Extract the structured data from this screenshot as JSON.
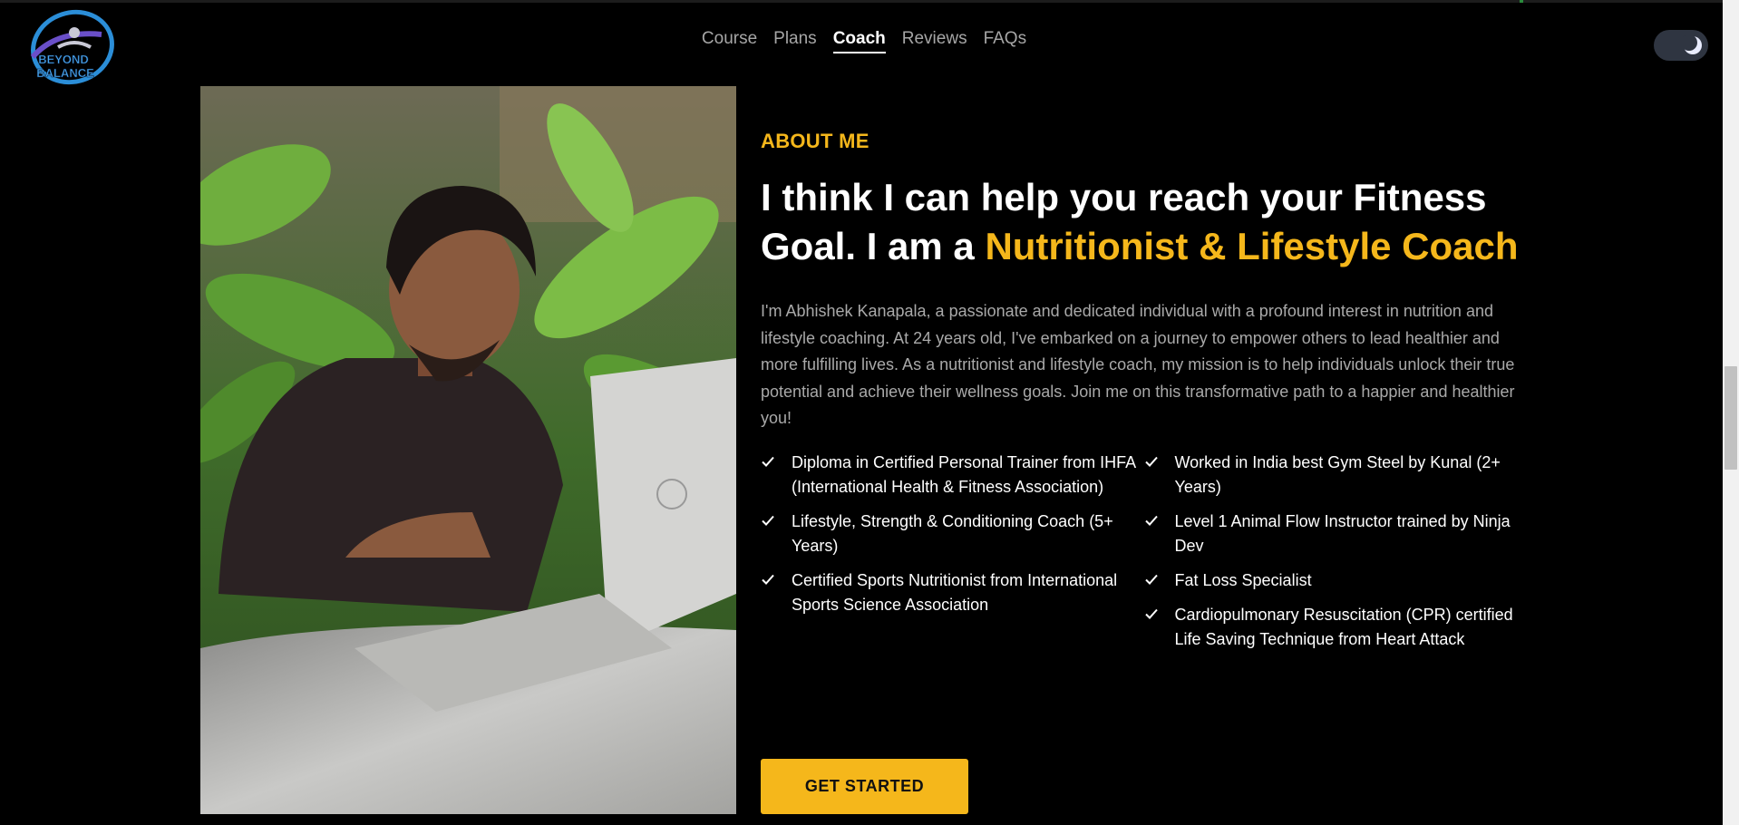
{
  "brand": {
    "logo_text_line1": "BEYOND",
    "logo_text_line2": "BALANCE"
  },
  "nav": {
    "items": [
      {
        "label": "Course",
        "active": false
      },
      {
        "label": "Plans",
        "active": false
      },
      {
        "label": "Coach",
        "active": true
      },
      {
        "label": "Reviews",
        "active": false
      },
      {
        "label": "FAQs",
        "active": false
      }
    ]
  },
  "theme_toggle": {
    "icon": "moon-icon",
    "state": "dark"
  },
  "about": {
    "eyebrow": "ABOUT ME",
    "headline_plain": "I think I can help you reach your Fitness Goal. I am a ",
    "headline_highlight": "Nutritionist & Lifestyle Coach",
    "bio": "I'm Abhishek Kanapala, a passionate and dedicated individual with a profound interest in nutrition and lifestyle coaching. At 24 years old, I've embarked on a journey to empower others to lead healthier and more fulfilling lives. As a nutritionist and lifestyle coach, my mission is to help individuals unlock their true potential and achieve their wellness goals. Join me on this transformative path to a happier and healthier you!",
    "credentials_left": [
      "Diploma in Certified Personal Trainer from IHFA (International Health & Fitness Association)",
      "Lifestyle, Strength & Conditioning Coach (5+ Years)",
      "Certified Sports Nutritionist from International Sports Science Association"
    ],
    "credentials_right": [
      "Worked in India best Gym Steel by Kunal (2+ Years)",
      "Level 1 Animal Flow Instructor trained by Ninja Dev",
      "Fat Loss Specialist",
      "Cardiopulmonary Resuscitation (CPR) certified Life Saving Technique from Heart Attack"
    ],
    "cta_label": "GET STARTED"
  },
  "colors": {
    "accent": "#f5b71b",
    "background": "#000000",
    "muted_text": "#a9a9a9"
  }
}
